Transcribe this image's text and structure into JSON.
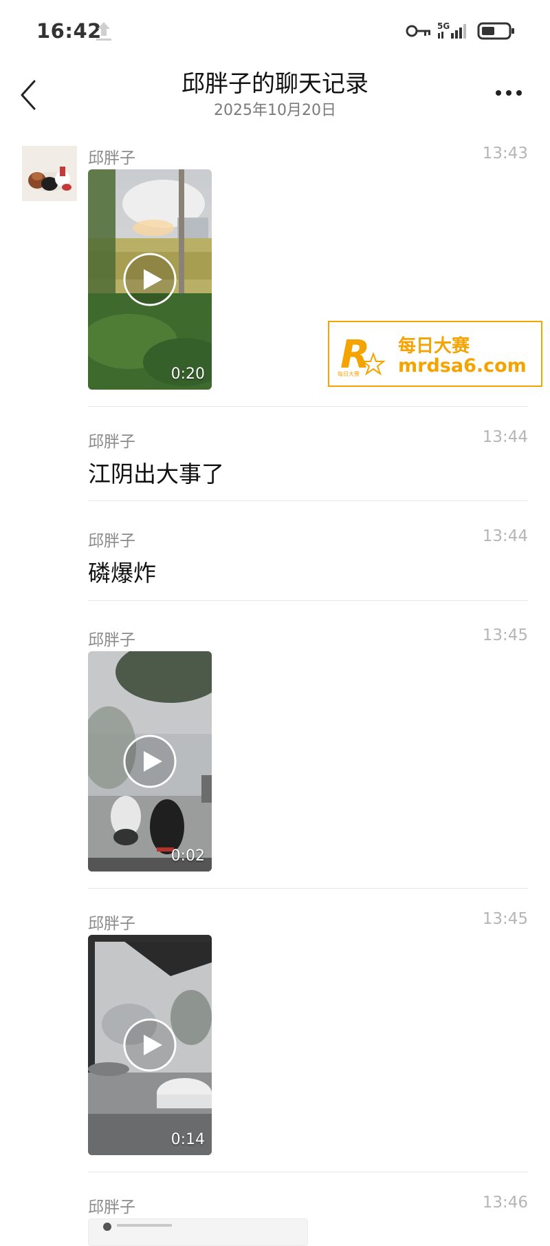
{
  "status_bar": {
    "time": "16:42",
    "network": "5G",
    "icons": [
      "upload-icon",
      "key-icon",
      "signal-icon",
      "battery-icon"
    ]
  },
  "header": {
    "title": "邱胖子的聊天记录",
    "subtitle": "2025年10月20日",
    "back_icon": "chevron-left-icon",
    "more_icon": "more-icon"
  },
  "watermark": {
    "name": "每日大赛",
    "url": "mrdsa6.com",
    "small_text": "每日大赛",
    "color": "#f5a300"
  },
  "messages": [
    {
      "sender": "邱胖子",
      "time": "13:43",
      "type": "video",
      "duration": "0:20"
    },
    {
      "sender": "邱胖子",
      "time": "13:44",
      "type": "text",
      "text": "江阴出大事了"
    },
    {
      "sender": "邱胖子",
      "time": "13:44",
      "type": "text",
      "text": "磷爆炸"
    },
    {
      "sender": "邱胖子",
      "time": "13:45",
      "type": "video",
      "duration": "0:02"
    },
    {
      "sender": "邱胖子",
      "time": "13:45",
      "type": "video",
      "duration": "0:14"
    },
    {
      "sender": "邱胖子",
      "time": "13:46",
      "type": "card"
    }
  ],
  "colors": {
    "sender": "#8a8a8a",
    "time": "#b5b5b5",
    "divider": "#e6e6e6"
  }
}
